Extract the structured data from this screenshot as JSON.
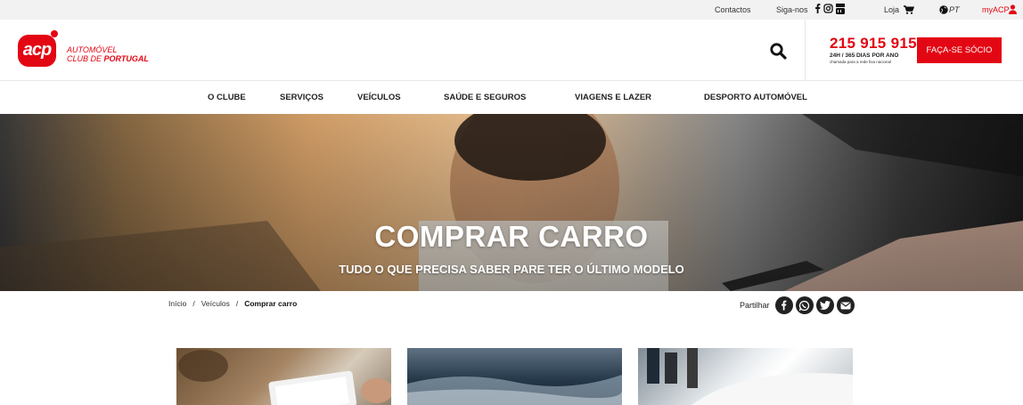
{
  "topbar": {
    "contacts": "Contactos",
    "follow": "Siga-nos",
    "store": "Loja",
    "language": "PT",
    "my_account": "myACP"
  },
  "header": {
    "logo_mark": "acp",
    "logo_line1": "AUTOMÓVEL",
    "logo_line2a": "CLUB DE ",
    "logo_line2b": "PORTUGAL",
    "phone": "215 915 915",
    "phone_hours": "24H / 365 DIAS POR ANO",
    "phone_note": "chamada para a rede fixa nacional",
    "cta": "FAÇA-SE SÓCIO"
  },
  "nav": {
    "items": [
      "O CLUBE",
      "SERVIÇOS",
      "VEÍCULOS",
      "SAÚDE E SEGUROS",
      "VIAGENS E LAZER",
      "DESPORTO AUTOMÓVEL"
    ]
  },
  "hero": {
    "title": "COMPRAR CARRO",
    "subtitle": "TUDO O QUE PRECISA SABER PARE TER O ÚLTIMO MODELO"
  },
  "breadcrumb": {
    "items": [
      "Início",
      "Veículos",
      "Comprar carro"
    ],
    "separator": "/"
  },
  "share": {
    "label": "Partilhar"
  },
  "colors": {
    "brand_red": "#e30613",
    "dark": "#222222"
  }
}
